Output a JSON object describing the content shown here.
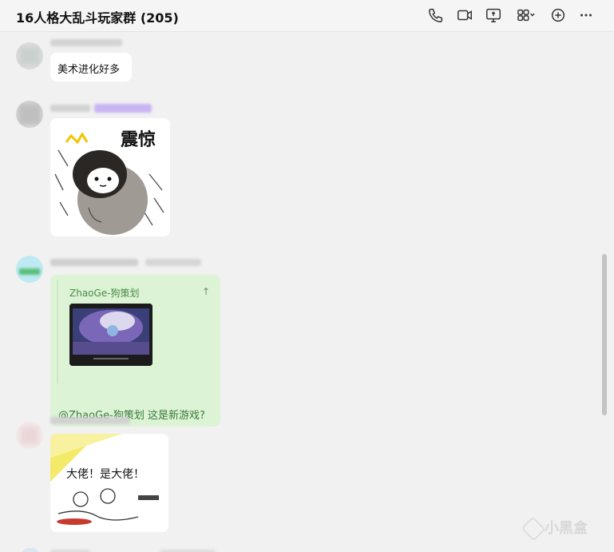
{
  "header": {
    "title": "16人格大乱斗玩家群 (205)",
    "icons": [
      "phone-icon",
      "video-call-icon",
      "screen-share-icon",
      "apps-icon",
      "add-icon",
      "more-icon"
    ]
  },
  "messages": [
    {
      "type": "text",
      "text": "美术进化好多"
    },
    {
      "type": "sticker",
      "caption": "震惊"
    },
    {
      "type": "reply",
      "quote_author": "ZhaoGe-狗策划",
      "text": "@ZhaoGe-狗策划 这是新游戏?"
    },
    {
      "type": "sticker",
      "caption": "大佬！是大佬！"
    }
  ],
  "watermark": {
    "text": "小黑盒"
  },
  "colors": {
    "header_bg": "#f5f5f5",
    "chat_bg": "#f1f1f1",
    "self_bubble": "#dcf3d6",
    "link_text": "#3b7a3a"
  }
}
